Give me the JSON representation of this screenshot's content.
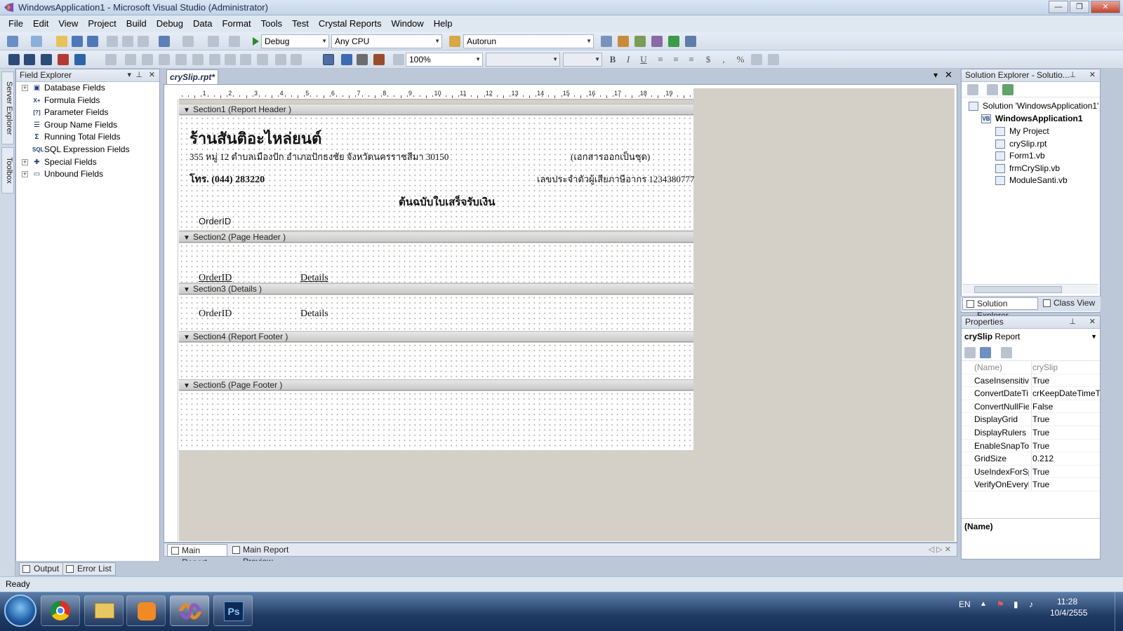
{
  "window": {
    "title": "WindowsApplication1 - Microsoft Visual Studio (Administrator)",
    "controls": {
      "minimize": "—",
      "restore": "❐",
      "close": "✕"
    }
  },
  "menu": [
    "File",
    "Edit",
    "View",
    "Project",
    "Build",
    "Debug",
    "Data",
    "Format",
    "Tools",
    "Test",
    "Crystal Reports",
    "Window",
    "Help"
  ],
  "toolbar": {
    "config": "Debug",
    "platform": "Any CPU",
    "find_combo": "Autorun",
    "zoom": "100%",
    "font_combo": "",
    "size_combo": "",
    "format_buttons": [
      "B",
      "I",
      "U",
      "≡",
      "≡",
      "≡",
      "$",
      ",",
      "%"
    ]
  },
  "left_strip": {
    "server_explorer": "Server Explorer",
    "toolbox": "Toolbox"
  },
  "field_explorer": {
    "title": "Field Explorer",
    "items": [
      {
        "label": "Database Fields",
        "icon": "database-icon",
        "expandable": true
      },
      {
        "label": "Formula Fields",
        "icon": "formula-icon",
        "expandable": false
      },
      {
        "label": "Parameter Fields",
        "icon": "parameter-icon",
        "expandable": false
      },
      {
        "label": "Group Name Fields",
        "icon": "group-icon",
        "expandable": false
      },
      {
        "label": "Running Total Fields",
        "icon": "sigma-icon",
        "expandable": false
      },
      {
        "label": "SQL Expression Fields",
        "icon": "sql-icon",
        "expandable": false
      },
      {
        "label": "Special Fields",
        "icon": "special-icon",
        "expandable": true
      },
      {
        "label": "Unbound Fields",
        "icon": "unbound-icon",
        "expandable": true
      }
    ]
  },
  "document": {
    "tab": "crySlip.rpt*",
    "ruler_numbers": [
      "1",
      "2",
      "3",
      "4",
      "5",
      "6",
      "7",
      "8",
      "9",
      "10",
      "11",
      "12",
      "13",
      "14",
      "15",
      "16",
      "17",
      "18",
      "19"
    ],
    "sections": [
      {
        "name": "Section1 (Report Header )"
      },
      {
        "name": "Section2 (Page Header )"
      },
      {
        "name": "Section3 (Details )"
      },
      {
        "name": "Section4 (Report Footer )"
      },
      {
        "name": "Section5 (Page Footer )"
      }
    ],
    "report_header": {
      "shop_name": "ร้านสันติอะไหล่ยนต์",
      "address": "355 หมู่ 12 ตำบลเมืองปัก อำเภอปักธงชัย จังหวัดนครราชสีมา 30150",
      "doc_note": "(เอกสารออกเป็นชุด)",
      "phone": "โทร. (044) 283220",
      "tax_id": "เลขประจำตัวผู้เสียภาษีอากร 1234380777",
      "doc_title": "ต้นฉบับใบเสร็จรับเงิน",
      "order_field": "OrderID"
    },
    "page_header": {
      "col1": "OrderID",
      "col2": "Details"
    },
    "details": {
      "col1": "OrderID",
      "col2": "Details"
    },
    "bottom_tabs": [
      "Main Report",
      "Main Report Preview"
    ]
  },
  "solution_explorer": {
    "title": "Solution Explorer - Solutio...",
    "solution": "Solution 'WindowsApplication1'",
    "project": "WindowsApplication1",
    "items": [
      "My Project",
      "crySlip.rpt",
      "Form1.vb",
      "frmCrySlip.vb",
      "ModuleSanti.vb"
    ],
    "tabs": [
      "Solution Explorer",
      "Class View"
    ]
  },
  "properties": {
    "title": "Properties",
    "object_name": "crySlip",
    "object_type": "Report",
    "rows": [
      {
        "key": "(Name)",
        "value": "crySlip"
      },
      {
        "key": "CaseInsensitive",
        "value": "True"
      },
      {
        "key": "ConvertDateTi",
        "value": "crKeepDateTimeTy"
      },
      {
        "key": "ConvertNullFie",
        "value": "False"
      },
      {
        "key": "DisplayGrid",
        "value": "True"
      },
      {
        "key": "DisplayRulers",
        "value": "True"
      },
      {
        "key": "EnableSnapTo",
        "value": "True"
      },
      {
        "key": "GridSize",
        "value": "0.212"
      },
      {
        "key": "UseIndexForSp",
        "value": "True"
      },
      {
        "key": "VerifyOnEveryF",
        "value": "True"
      }
    ],
    "description_title": "(Name)"
  },
  "tool_windows": [
    "Output",
    "Error List"
  ],
  "status": "Ready",
  "tray": {
    "lang": "EN",
    "time": "11:28",
    "date": "10/4/2555"
  }
}
